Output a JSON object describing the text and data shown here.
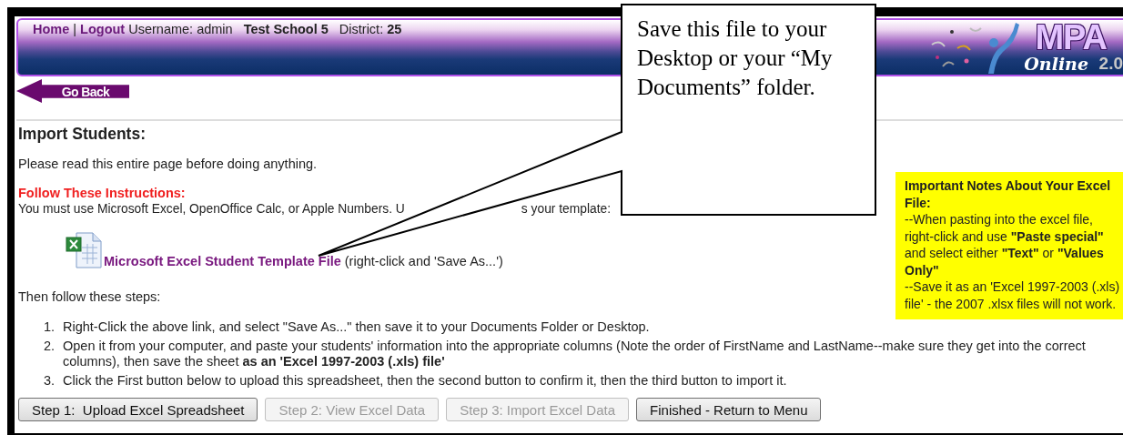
{
  "header": {
    "links": [
      {
        "label": "Home"
      },
      {
        "label": "Logout"
      }
    ],
    "separator": "|",
    "username": "Username: admin",
    "school": "Test School 5",
    "district_label": "District:",
    "district": "25",
    "logo": {
      "title": "MPA",
      "subtitle": "Online",
      "version": "2.0"
    }
  },
  "back_button": "Go Back",
  "page_title": "Import Students:",
  "intro": "Please read this entire page before doing anything.",
  "instructions_heading": "Follow These Instructions:",
  "instructions_text": [
    "You must use Microsoft Excel, OpenOffice Calc, or Apple Numbers. U",
    "s your template:"
  ],
  "template_link": {
    "text": "Microsoft Excel Student Template File",
    "note": "(right-click and 'Save As...')"
  },
  "notes": {
    "title": "Important Notes About Your Excel File:",
    "paragraphs": [
      "--When pasting into the excel file, right-click and use **\"Paste special\"** and select either **\"Text\"** or **\"Values Only\"**",
      "--Save it as an 'Excel 1997-2003 (.xls) file' - the 2007 .xlsx files will not work."
    ]
  },
  "steps_intro": "Then follow these steps:",
  "steps": [
    {
      "number": "1.",
      "text": "Right-Click the above link, and select \"Save As...\" then save it to your Documents Folder or Desktop."
    },
    {
      "number": "2.",
      "text": "Open it from your computer, and paste your students' information into the appropriate columns (Note the order of FirstName and LastName--make sure they get into the correct columns), then save the sheet **as an 'Excel 1997-2003 (.xls) file'**"
    },
    {
      "number": "3.",
      "text": "Click the First button below to upload this spreadsheet, then the second button to confirm it, then the third button to import it."
    }
  ],
  "buttons": [
    {
      "label": "Step 1:  Upload Excel Spreadsheet",
      "disabled": false
    },
    {
      "label": "Step 2: View Excel Data",
      "disabled": true
    },
    {
      "label": "Step 3: Import Excel Data",
      "disabled": true
    },
    {
      "label": "Finished - Return to Menu",
      "disabled": false
    }
  ],
  "callout": "Save this file to your Desktop or your “My Documents” folder."
}
